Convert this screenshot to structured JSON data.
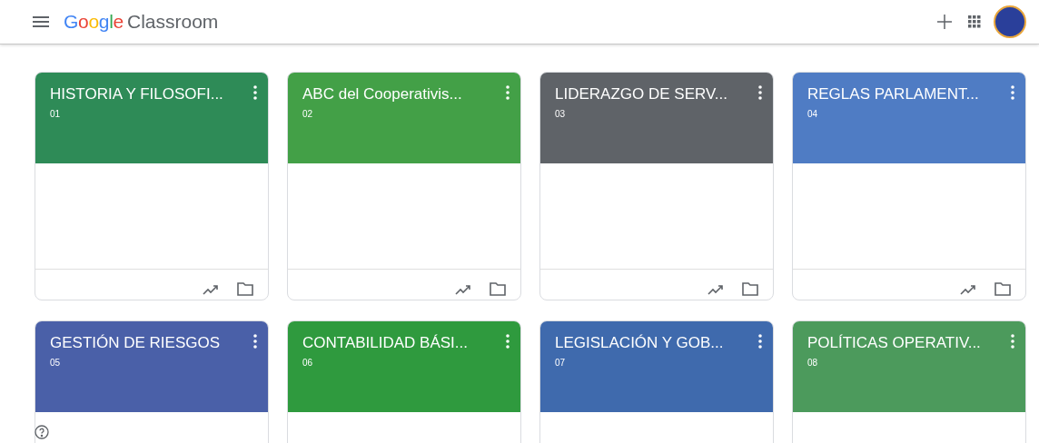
{
  "header": {
    "logo_word": "Google",
    "product": "Classroom"
  },
  "courses": [
    {
      "title": "HISTORIA Y FILOSOFI...",
      "section": "01",
      "color": "#2e8b57"
    },
    {
      "title": "ABC del Cooperativis...",
      "section": "02",
      "color": "#43a047"
    },
    {
      "title": "LIDERAZGO DE SERV...",
      "section": "03",
      "color": "#5f6368"
    },
    {
      "title": "REGLAS PARLAMENT...",
      "section": "04",
      "color": "#4f7cc4"
    },
    {
      "title": "GESTIÓN DE RIESGOS",
      "section": "05",
      "color": "#4a60a8"
    },
    {
      "title": "CONTABILIDAD BÁSI...",
      "section": "06",
      "color": "#2f9a3e"
    },
    {
      "title": "LEGISLACIÓN Y GOB...",
      "section": "07",
      "color": "#3f6aad"
    },
    {
      "title": "POLÍTICAS OPERATIV...",
      "section": "08",
      "color": "#4c9a5c"
    }
  ]
}
